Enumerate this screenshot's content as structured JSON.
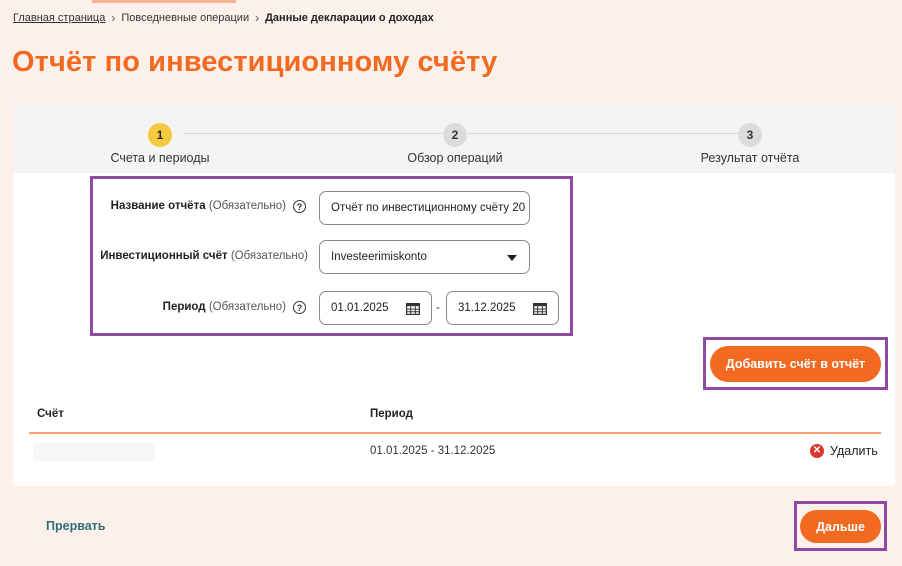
{
  "breadcrumb": {
    "home": "Главная страница",
    "section": "Повседневные операции",
    "current": "Данные декларации о доходах"
  },
  "page_title": "Отчёт по инвестиционному счёту",
  "stepper": {
    "steps": [
      {
        "number": "1",
        "label": "Счета и периоды",
        "state": "active"
      },
      {
        "number": "2",
        "label": "Обзор операций",
        "state": "inactive"
      },
      {
        "number": "3",
        "label": "Результат отчёта",
        "state": "inactive"
      }
    ]
  },
  "form": {
    "report_name": {
      "label": "Название отчёта",
      "required": "(Обязательно)",
      "value": "Отчёт по инвестиционному счёту 20"
    },
    "account": {
      "label": "Инвестиционный счёт",
      "required": "(Обязательно)",
      "value": "Investeerimiskonto"
    },
    "period": {
      "label": "Период",
      "required": "(Обязательно)",
      "from": "01.01.2025",
      "separator": "-",
      "to": "31.12.2025"
    }
  },
  "add_account_button": "Добавить счёт в отчёт",
  "table": {
    "headers": {
      "account": "Счёт",
      "period": "Период"
    },
    "rows": [
      {
        "account": "",
        "period": "01.01.2025 - 31.12.2025",
        "delete_label": "Удалить"
      }
    ]
  },
  "footer": {
    "cancel_label": "Прервать",
    "next_label": "Дальше"
  },
  "colors": {
    "accent": "#f26a21",
    "active_step": "#f7c93e",
    "highlight_frame": "#8e4aa0",
    "link": "#2e6f78",
    "delete": "#d6372f"
  },
  "icons": {
    "help": "question-circle-icon",
    "dropdown": "chevron-down-icon",
    "calendar": "calendar-icon",
    "delete": "close-circle-icon",
    "breadcrumb_sep": "chevron-right-icon"
  }
}
